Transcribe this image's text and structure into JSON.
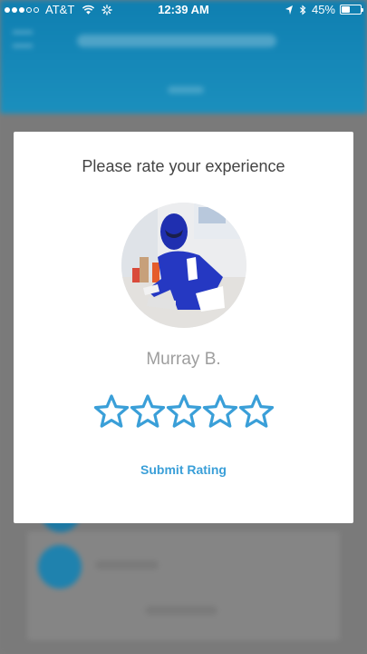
{
  "status_bar": {
    "carrier": "AT&T",
    "time": "12:39 AM",
    "battery": "45%",
    "battery_level": 0.45
  },
  "modal": {
    "title": "Please rate your experience",
    "provider_name": "Murray B.",
    "stars": 5,
    "star_color": "#3a9fd8",
    "submit_label": "Submit Rating"
  },
  "colors": {
    "header_blue": "#1b8fbd",
    "accent": "#3a9fd8"
  }
}
